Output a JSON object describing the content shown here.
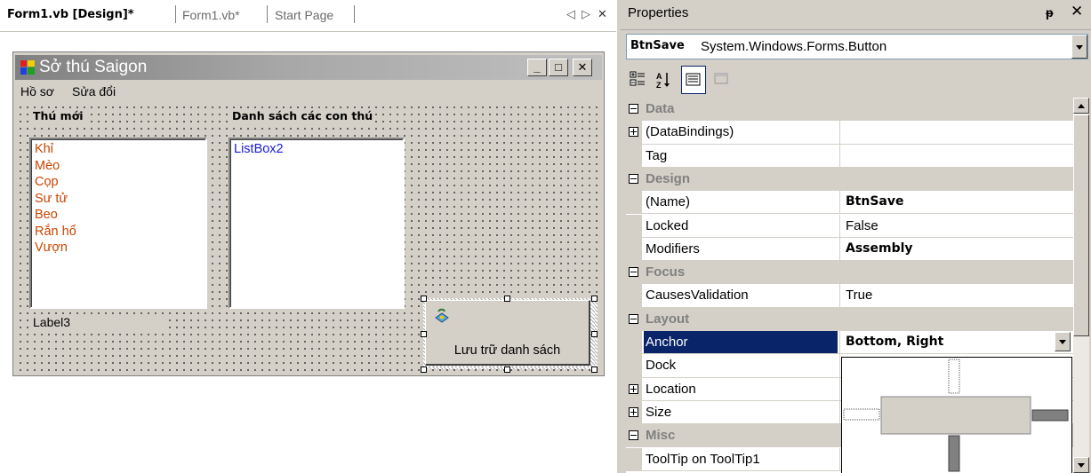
{
  "tabs": {
    "active": "Form1.vb [Design]*",
    "items": [
      "Form1.vb*",
      "Start Page"
    ],
    "nav_left": "◁",
    "nav_right": "▷",
    "close": "✕"
  },
  "form": {
    "title": "Sở thú Saigon",
    "menu": [
      "Hồ sơ",
      "Sửa đổi"
    ],
    "label_new": "Thú mới",
    "label_list": "Danh sách các con thú",
    "listbox1_items": [
      "Khỉ",
      "Mèo",
      "Cọp",
      "Sư tử",
      "Beo",
      "Rắn hổ",
      "Vượn"
    ],
    "listbox2_text": "ListBox2",
    "label3": "Label3",
    "save_button": "Lưu trữ danh sách",
    "minimize": "_",
    "maximize": "□",
    "close": "✕"
  },
  "properties": {
    "title": "Properties",
    "pin": "ᵽ",
    "close": "✕",
    "object_name": "BtnSave",
    "object_type": "System.Windows.Forms.Button",
    "toolbar": [
      "categorized-icon",
      "alphabetical-icon",
      "properties-icon",
      "events-icon"
    ],
    "rows": [
      {
        "kind": "cat",
        "name": "Data"
      },
      {
        "kind": "prop",
        "name": "(DataBindings)",
        "value": "",
        "expand": "plus"
      },
      {
        "kind": "prop",
        "name": "Tag",
        "value": ""
      },
      {
        "kind": "cat",
        "name": "Design"
      },
      {
        "kind": "prop",
        "name": "(Name)",
        "value": "BtnSave",
        "bold": true
      },
      {
        "kind": "prop",
        "name": "Locked",
        "value": "False"
      },
      {
        "kind": "prop",
        "name": "Modifiers",
        "value": "Assembly",
        "bold": true
      },
      {
        "kind": "cat",
        "name": "Focus"
      },
      {
        "kind": "prop",
        "name": "CausesValidation",
        "value": "True"
      },
      {
        "kind": "cat",
        "name": "Layout"
      },
      {
        "kind": "prop",
        "name": "Anchor",
        "value": "Bottom, Right",
        "bold": true,
        "selected": true
      },
      {
        "kind": "prop",
        "name": "Dock",
        "value": ""
      },
      {
        "kind": "prop",
        "name": "Location",
        "value": "",
        "expand": "plus"
      },
      {
        "kind": "prop",
        "name": "Size",
        "value": "",
        "expand": "plus"
      },
      {
        "kind": "cat",
        "name": "Misc"
      },
      {
        "kind": "prop",
        "name": "ToolTip on ToolTip1",
        "value": ""
      }
    ]
  },
  "colors": {
    "selection": "#0a246a",
    "list_item": "#cc4400",
    "listbox2_text": "#1a1ae0",
    "face": "#d4d0c8"
  }
}
